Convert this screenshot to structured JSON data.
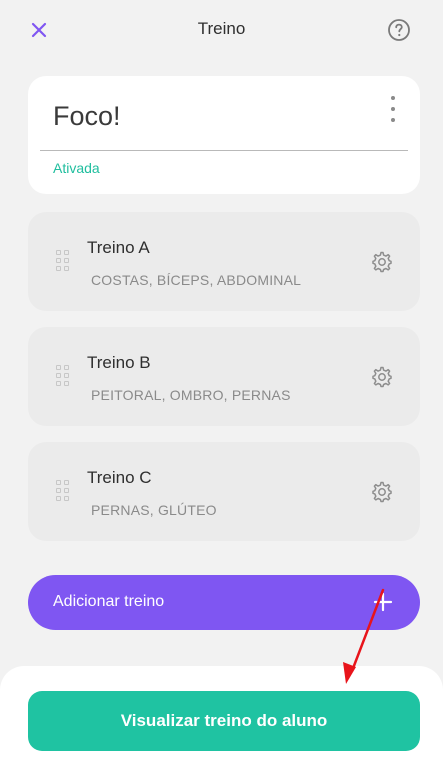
{
  "header": {
    "title": "Treino",
    "close_icon": "close-icon",
    "help_icon": "help-circle-icon"
  },
  "plan": {
    "name": "Foco!",
    "status": "Ativada",
    "menu_icon": "more-vertical-icon"
  },
  "workouts": [
    {
      "title": "Treino A",
      "muscles": "COSTAS, BÍCEPS, ABDOMINAL"
    },
    {
      "title": "Treino B",
      "muscles": "PEITORAL, OMBRO, PERNAS"
    },
    {
      "title": "Treino C",
      "muscles": "PERNAS, GLÚTEO"
    }
  ],
  "add_workout": {
    "label": "Adicionar treino",
    "icon": "plus-icon"
  },
  "primary_action": {
    "label": "Visualizar treino do aluno"
  },
  "colors": {
    "accent_purple": "#7f56f2",
    "accent_teal": "#1fc3a2",
    "status_green": "#1fbe9e",
    "annotation_red": "#e8141b"
  }
}
